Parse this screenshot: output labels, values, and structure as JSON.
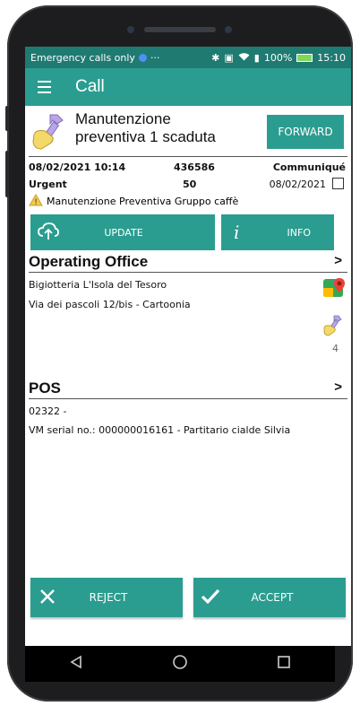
{
  "status_bar": {
    "left_text": "Emergency calls only",
    "more": "···",
    "battery": "100%",
    "time": "15:10"
  },
  "app_bar": {
    "title": "Call"
  },
  "call": {
    "title": "Manutenzione preventiva 1 scaduta",
    "forward_label": "FORWARD",
    "date_time": "08/02/2021 10:14",
    "number": "436586",
    "communique_label": "Communiqué",
    "priority": "Urgent",
    "priority_value": "50",
    "communique_date": "08/02/2021",
    "warning_text": "Manutenzione Preventiva Gruppo caffè",
    "update_label": "UPDATE",
    "info_label": "INFO",
    "info_icon": "i"
  },
  "operating_office": {
    "heading": "Operating Office",
    "chevron": ">",
    "name": "Bigiotteria L'Isola del Tesoro",
    "address": "Via dei pascoli 12/bis - Cartoonia",
    "interventions_count": "4"
  },
  "pos": {
    "heading": "POS",
    "chevron": ">",
    "code": "02322 -",
    "serial": "VM serial no.: 000000016161 - Partitario cialde Silvia"
  },
  "actions": {
    "reject_label": "REJECT",
    "accept_label": "ACCEPT"
  },
  "colors": {
    "accent": "#2a9d90",
    "status_bar": "#1f7a72",
    "warning": "#f2c94c"
  },
  "icons": [
    "hamburger-menu-icon",
    "wrench-hand-icon",
    "cloud-upload-icon",
    "info-icon",
    "maps-pin-icon",
    "close-icon",
    "check-icon",
    "back-icon",
    "home-icon",
    "recents-icon"
  ]
}
